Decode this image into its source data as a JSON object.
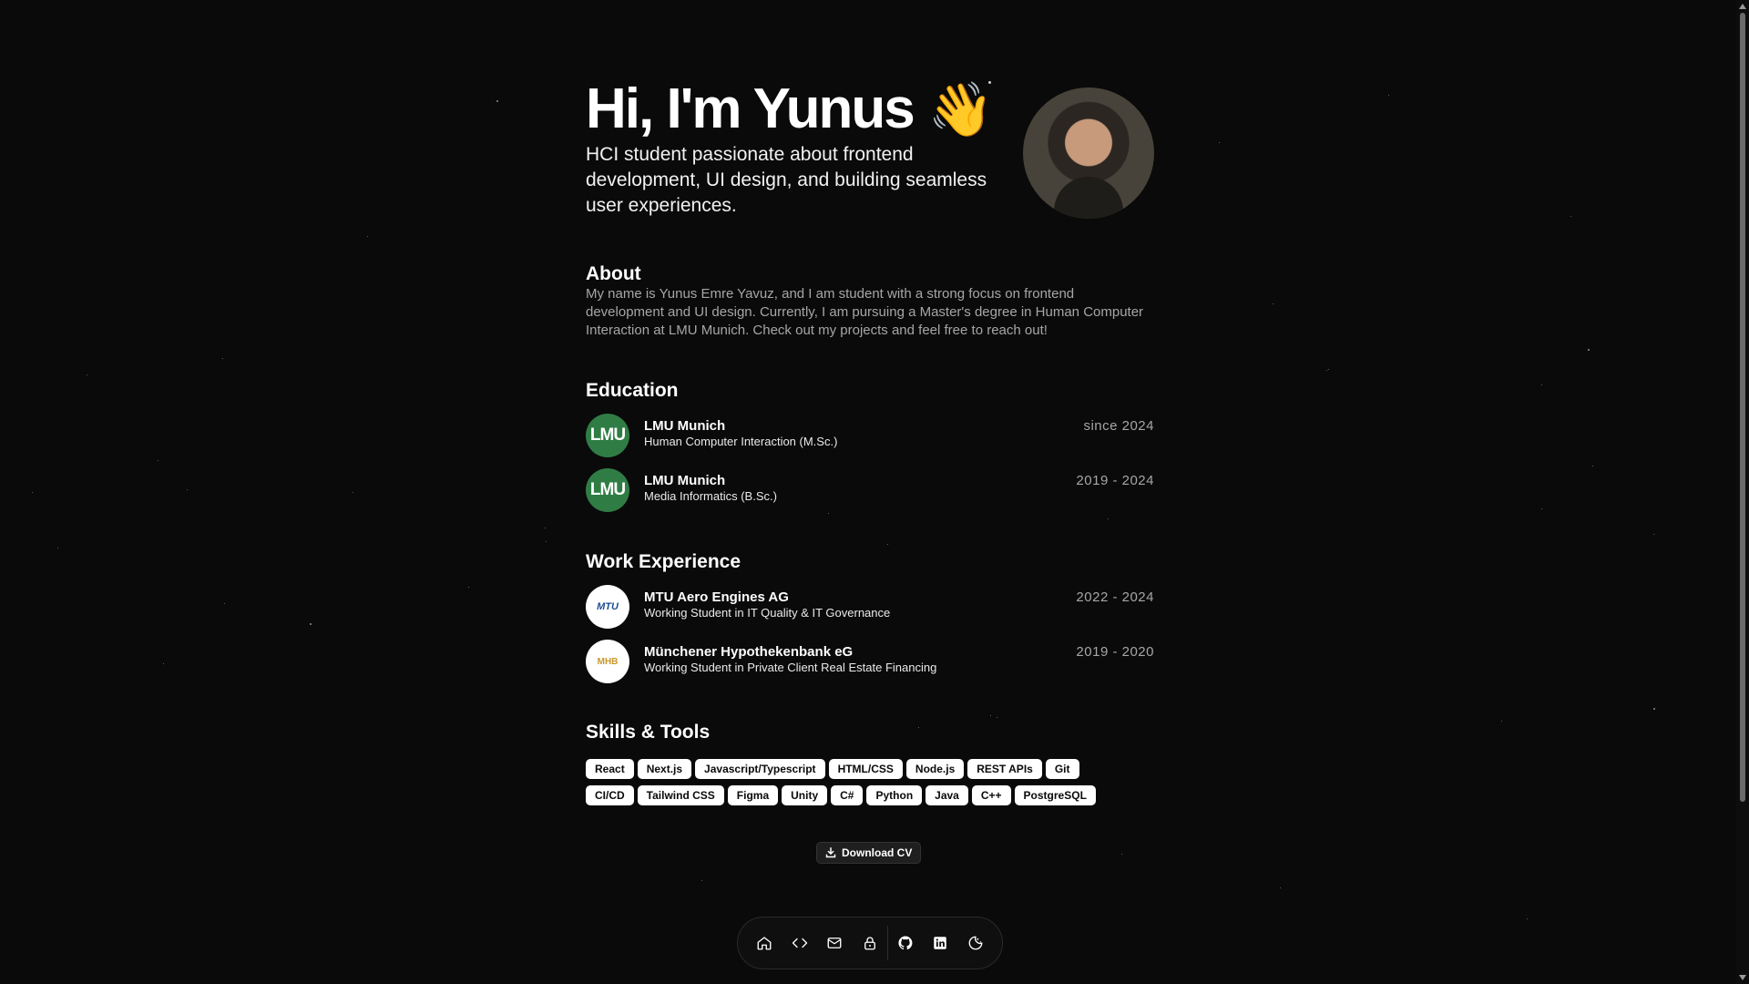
{
  "hero": {
    "title": "Hi, I'm Yunus",
    "wave_emoji": "👋",
    "subtitle": "HCI student passionate about frontend development, UI design, and building seamless user experiences."
  },
  "about": {
    "title": "About",
    "text": "My name is Yunus Emre Yavuz, and I am student with a strong focus on frontend development and UI design. Currently, I am pursuing a Master's degree in Human Computer Interaction at LMU Munich. Check out my projects and feel free to reach out!"
  },
  "education": {
    "title": "Education",
    "items": [
      {
        "logo_text": "LMU",
        "name": "LMU Munich",
        "role": "Human Computer Interaction (M.Sc.)",
        "date": "since 2024"
      },
      {
        "logo_text": "LMU",
        "name": "LMU Munich",
        "role": "Media Informatics (B.Sc.)",
        "date": "2019 - 2024"
      }
    ]
  },
  "work": {
    "title": "Work Experience",
    "items": [
      {
        "logo_text": "MTU",
        "name": "MTU Aero Engines AG",
        "role": "Working Student in IT Quality & IT Governance",
        "date": "2022 - 2024"
      },
      {
        "logo_text": "MHB",
        "name": "Münchener Hypothekenbank eG",
        "role": "Working Student in Private Client Real Estate Financing",
        "date": "2019 - 2020"
      }
    ]
  },
  "skills": {
    "title": "Skills & Tools",
    "row1": [
      "React",
      "Next.js",
      "Javascript/Typescript",
      "HTML/CSS",
      "Node.js",
      "REST APIs",
      "Git"
    ],
    "row2": [
      "CI/CD",
      "Tailwind CSS",
      "Figma",
      "Unity",
      "C#",
      "Python",
      "Java",
      "C++",
      "PostgreSQL"
    ]
  },
  "cv_button": {
    "label": "Download CV",
    "icon": "download-icon"
  },
  "dock": {
    "items": [
      "home-icon",
      "code-icon",
      "mail-icon",
      "lock-icon",
      "github-icon",
      "linkedin-icon",
      "theme-toggle-icon"
    ]
  },
  "colors": {
    "background": "#0a0a0a",
    "text": "#ffffff",
    "muted": "#a6a6a6",
    "lmu_green": "#2f7d45",
    "chip_bg": "#ffffff"
  }
}
